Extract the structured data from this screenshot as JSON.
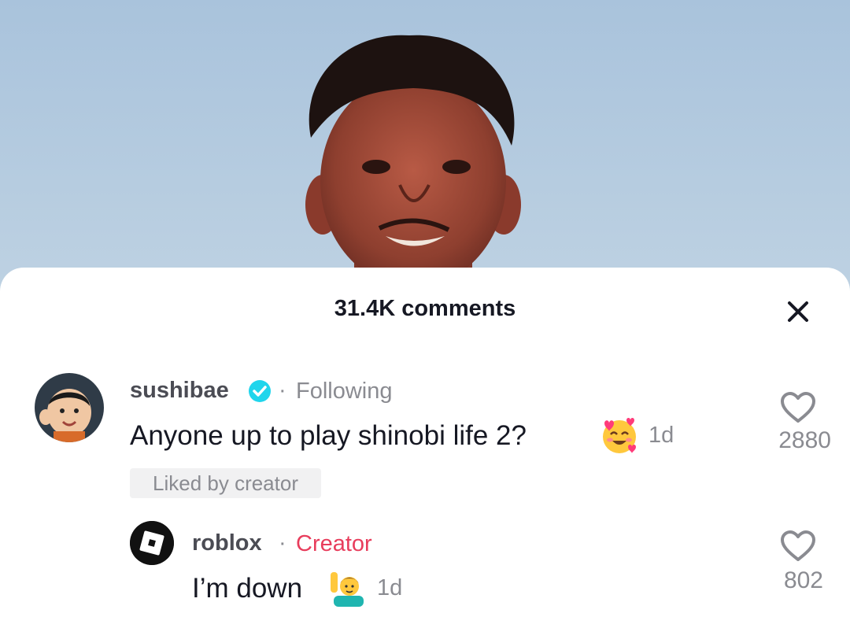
{
  "sheet": {
    "title": "31.4K comments"
  },
  "comments": [
    {
      "username": "sushibae",
      "verified": true,
      "relation": "Following",
      "text": "Anyone up to play shinobi life 2?",
      "emoji": "smiling-face-with-hearts",
      "time": "1d",
      "badge": "Liked by creator",
      "likes": "2880"
    }
  ],
  "reply": {
    "username": "roblox",
    "tag": "Creator",
    "text": "I’m down",
    "emoji": "man-raising-hand",
    "time": "1d",
    "likes": "802"
  },
  "colors": {
    "creator_tag": "#e83d5c",
    "verified": "#20d5ec",
    "secondary_text": "#8a8b91",
    "primary_text": "#161823"
  }
}
